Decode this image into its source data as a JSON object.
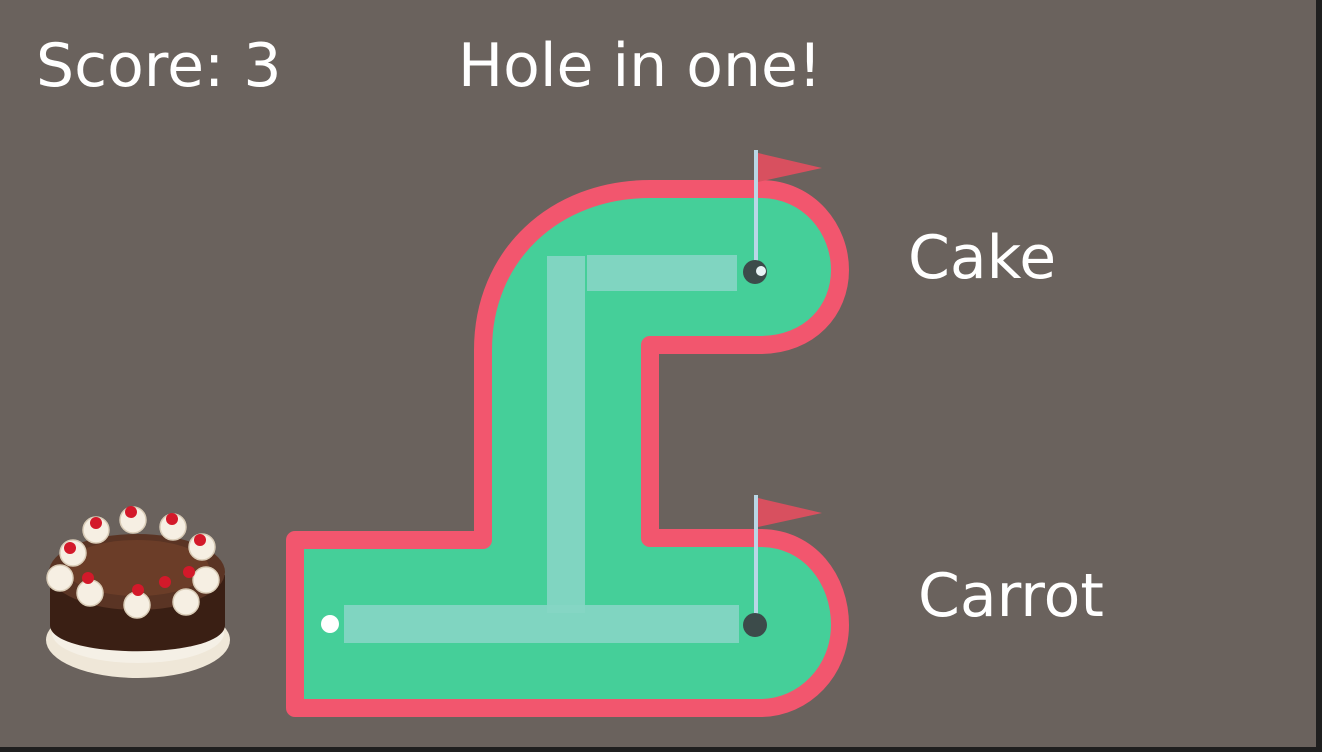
{
  "hud": {
    "score_label": "Score: 3",
    "message": "Hole in one!"
  },
  "course": {
    "hole_top_label": "Cake",
    "hole_bottom_label": "Carrot"
  },
  "prize_icon": "cake-image",
  "colors": {
    "background": "#6a625d",
    "green": "#45cf99",
    "border": "#f2566e",
    "path": "#86d6c4",
    "flag": "#d8505f",
    "hole": "#3c4b4a",
    "ball": "#ffffff"
  }
}
